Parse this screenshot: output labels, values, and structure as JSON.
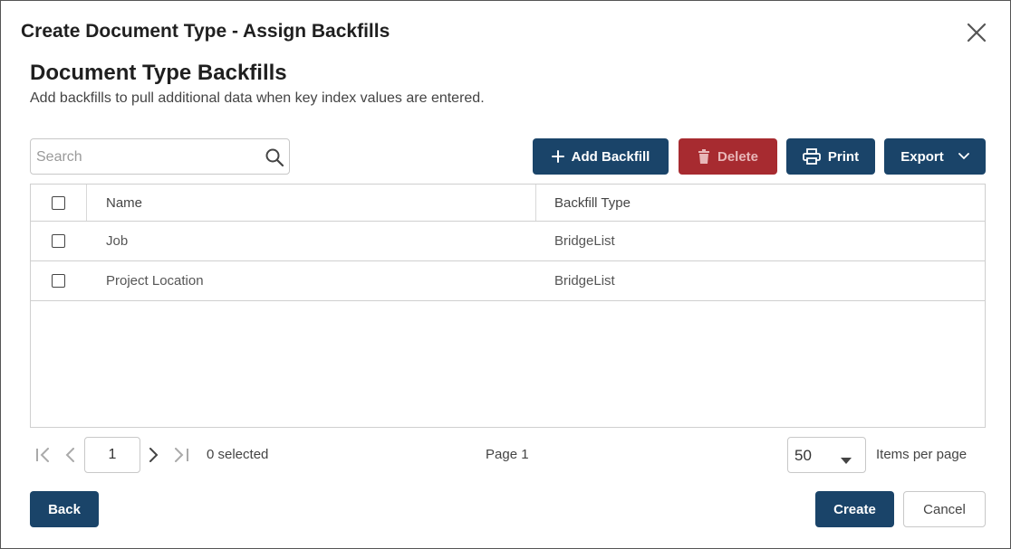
{
  "dialog": {
    "title": "Create Document Type - Assign Backfills",
    "close_icon": "close-icon"
  },
  "section": {
    "title": "Document Type Backfills",
    "description": "Add backfills to pull additional data when key index values are entered."
  },
  "search": {
    "placeholder": "Search",
    "value": "",
    "icon": "search-icon"
  },
  "toolbar": {
    "add_label": "Add Backfill",
    "delete_label": "Delete",
    "print_label": "Print",
    "export_label": "Export"
  },
  "colors": {
    "primary": "#1a4469",
    "danger": "#a72b30"
  },
  "grid": {
    "columns": [
      "Name",
      "Backfill Type"
    ],
    "rows": [
      {
        "name": "Job",
        "type": "BridgeList"
      },
      {
        "name": "Project Location",
        "type": "BridgeList"
      }
    ]
  },
  "pager": {
    "page_value": "1",
    "selected_text": "0 selected",
    "page_label": "Page 1",
    "per_page_value": "50",
    "per_page_label": "Items per page"
  },
  "footer": {
    "back_label": "Back",
    "create_label": "Create",
    "cancel_label": "Cancel"
  }
}
